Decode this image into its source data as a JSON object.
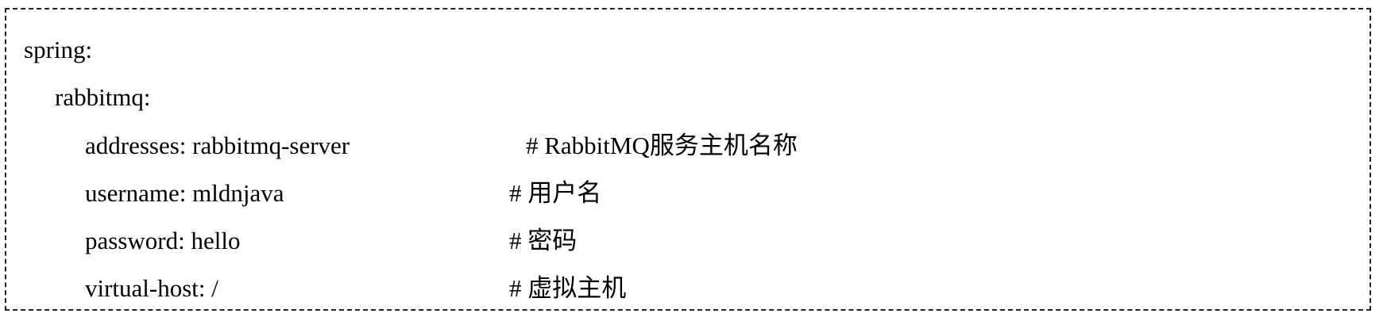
{
  "code": {
    "lines": [
      {
        "key": "spring:",
        "comment": ""
      },
      {
        "key": "rabbitmq:",
        "comment": ""
      },
      {
        "key": "addresses: rabbitmq-server",
        "comment": "# RabbitMQ服务主机名称"
      },
      {
        "key": "username: mldnjava",
        "comment": "#  用户名"
      },
      {
        "key": "password: hello",
        "comment": "#  密码"
      },
      {
        "key": "virtual-host: /",
        "comment": "#  虚拟主机"
      }
    ]
  }
}
